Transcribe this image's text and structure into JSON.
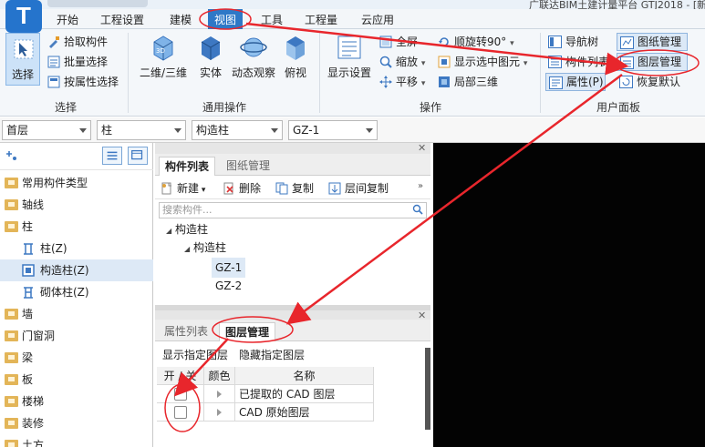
{
  "title": "广联达BIM土建计量平台 GTJ2018 - [新建",
  "menu": {
    "logo": "T",
    "items": [
      {
        "label": "开始"
      },
      {
        "label": "工程设置"
      },
      {
        "label": "建模"
      },
      {
        "label": "视图"
      },
      {
        "label": "工具"
      },
      {
        "label": "工程量"
      },
      {
        "label": "云应用"
      }
    ]
  },
  "ribbon": {
    "select_group": {
      "label": "选择",
      "select": "选择",
      "pick": "拾取构件",
      "batch": "批量选择",
      "by_attr": "按属性选择"
    },
    "common_group": {
      "label": "通用操作",
      "view2d3d": "二维/三维",
      "entity": "实体",
      "dynamic": "动态观察",
      "top": "俯视"
    },
    "ops_group": {
      "label": "操作",
      "display": "显示设置",
      "fullscreen": "全屏",
      "zoom": "缩放",
      "pan": "平移",
      "rotate": "顺旋转90°",
      "show_selected": "显示选中图元",
      "local3d": "局部三维"
    },
    "user_panel_group": {
      "label": "用户面板",
      "nav_tree": "导航树",
      "comp_list": "构件列表",
      "attr": "属性(P)",
      "drawing_mgmt": "图纸管理",
      "layer_mgmt": "图层管理",
      "restore": "恢复默认"
    }
  },
  "filters": {
    "floor": "首层",
    "category": "柱",
    "type": "构造柱",
    "component": "GZ-1"
  },
  "nav_tree": {
    "items": [
      {
        "label": "常用构件类型"
      },
      {
        "label": "轴线"
      },
      {
        "label": "柱"
      },
      {
        "label": "柱(Z)"
      },
      {
        "label": "构造柱(Z)"
      },
      {
        "label": "砌体柱(Z)"
      },
      {
        "label": "墙"
      },
      {
        "label": "门窗洞"
      },
      {
        "label": "梁"
      },
      {
        "label": "板"
      },
      {
        "label": "楼梯"
      },
      {
        "label": "装修"
      },
      {
        "label": "土方"
      }
    ]
  },
  "component_panel": {
    "tabs": [
      {
        "label": "构件列表"
      },
      {
        "label": "图纸管理"
      }
    ],
    "toolbar": {
      "new": "新建",
      "delete": "删除",
      "copy": "复制",
      "floor_copy": "层间复制"
    },
    "search_placeholder": "搜索构件...",
    "tree": [
      "构造柱",
      "构造柱",
      "GZ-1",
      "GZ-2"
    ]
  },
  "layer_panel": {
    "tabs": [
      {
        "label": "属性列表"
      },
      {
        "label": "图层管理"
      }
    ],
    "show_layer": "显示指定图层",
    "hide_layer": "隐藏指定图层",
    "columns": {
      "toggle": "开 / 关",
      "color": "颜色",
      "name": "名称"
    },
    "rows": [
      {
        "name": "已提取的 CAD 图层",
        "checked": false
      },
      {
        "name": "CAD 原始图层",
        "checked": false
      }
    ]
  },
  "colors": {
    "accent": "#2e78c7",
    "annotation": "#e8262c",
    "canvas": "#030303"
  }
}
